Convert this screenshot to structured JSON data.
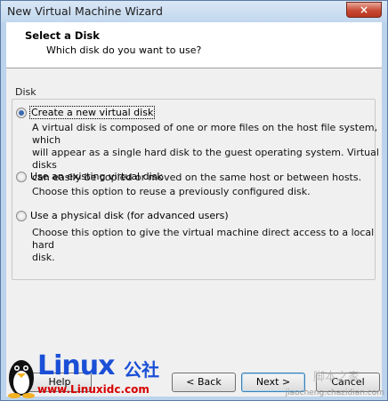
{
  "window": {
    "title": "New Virtual Machine Wizard",
    "close_glyph": "×"
  },
  "header": {
    "title": "Select a Disk",
    "subtitle": "Which disk do you want to use?"
  },
  "group": {
    "label": "Disk"
  },
  "options": [
    {
      "label": "Create a new virtual disk",
      "checked": true,
      "description": [
        "A virtual disk is composed of one or more files on the host file system, which",
        "will appear as a single hard disk to the guest operating system. Virtual disks",
        "can easily be copied or moved on the same host or between hosts."
      ]
    },
    {
      "label": "Use an existing virtual disk",
      "checked": false,
      "description": [
        "Choose this option to reuse a previously configured disk."
      ]
    },
    {
      "label": "Use a physical disk (for advanced users)",
      "checked": false,
      "description": [
        "Choose this option to give the virtual machine direct access to a local hard",
        "disk."
      ]
    }
  ],
  "buttons": {
    "help": "Help",
    "back": "< Back",
    "next": "Next >",
    "cancel": "Cancel"
  },
  "branding": {
    "logo_word": "Linux",
    "logo_suffix": "公社",
    "logo_url": "www.Linuxidc.com",
    "watermark_big": "脚本之家",
    "watermark_small": "jiaocheng.chazidian.com"
  },
  "colors": {
    "accent": "#3a6bb0",
    "logo_blue": "#1a4fd6",
    "logo_red": "#d60000"
  }
}
